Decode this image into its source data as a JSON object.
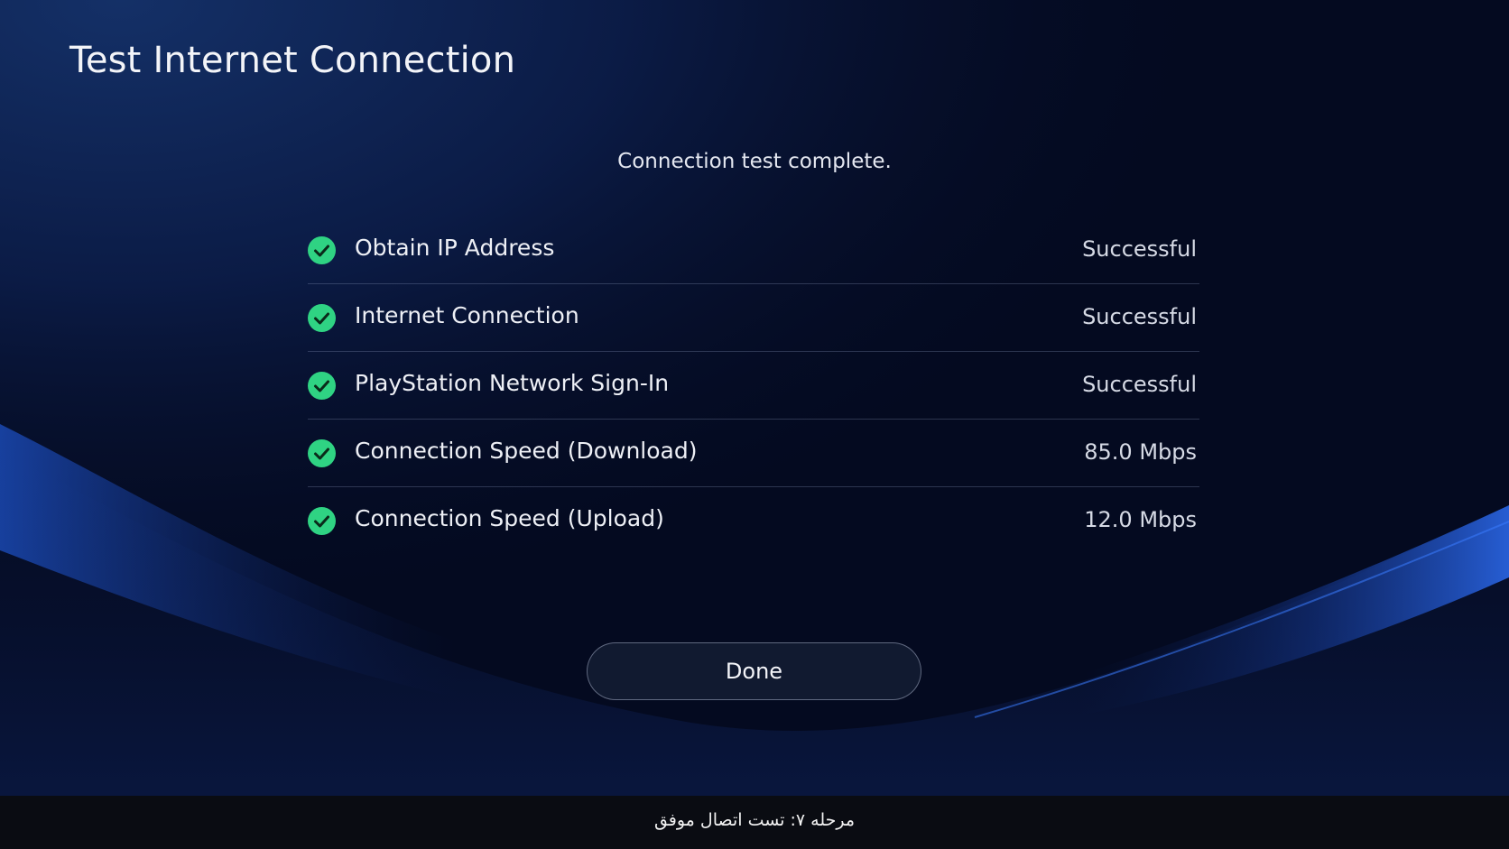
{
  "page": {
    "title": "Test Internet Connection",
    "status_message": "Connection test complete."
  },
  "results": [
    {
      "label": "Obtain IP Address",
      "value": "Successful",
      "status_icon": "check-circle-icon"
    },
    {
      "label": "Internet Connection",
      "value": "Successful",
      "status_icon": "check-circle-icon"
    },
    {
      "label": "PlayStation Network Sign-In",
      "value": "Successful",
      "status_icon": "check-circle-icon"
    },
    {
      "label": "Connection Speed (Download)",
      "value": "85.0 Mbps",
      "status_icon": "check-circle-icon"
    },
    {
      "label": "Connection Speed (Upload)",
      "value": "12.0 Mbps",
      "status_icon": "check-circle-icon"
    }
  ],
  "actions": {
    "done_label": "Done"
  },
  "caption": {
    "text": "مرحله ۷: تست اتصال موفق"
  },
  "colors": {
    "background": "#040a20",
    "accent_glow": "#1f57d6",
    "success": "#2fd383",
    "text": "#eef0f6"
  }
}
